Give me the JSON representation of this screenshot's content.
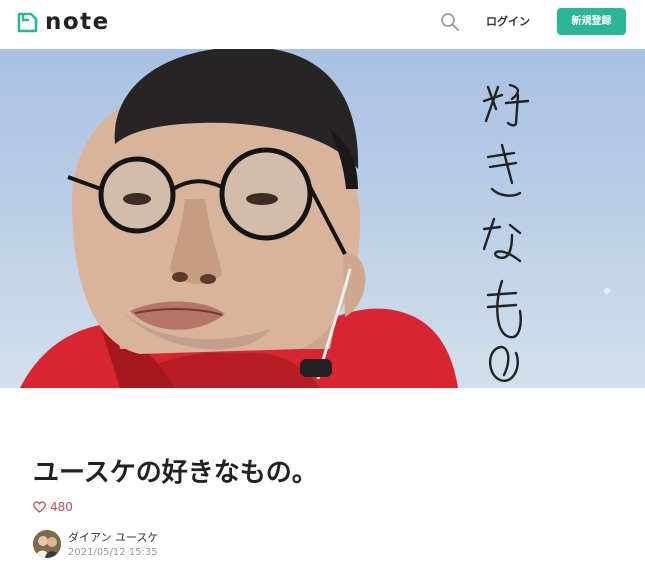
{
  "header": {
    "logo_text": "note",
    "logo_icon": "note-logo-icon",
    "search_icon": "search-icon",
    "login_label": "ログイン",
    "signup_label": "新規登録",
    "accent_color": "#2cb696"
  },
  "hero": {
    "image": "eyecatch-photo",
    "handwritten_caption": "好きなもの"
  },
  "article": {
    "title": "ユースケの好きなもの。",
    "likes": {
      "icon": "heart-icon",
      "count": "480"
    },
    "author": {
      "avatar": "avatar-image",
      "name": "ダイアン ユースケ",
      "date": "2021/05/12 15:35"
    }
  }
}
